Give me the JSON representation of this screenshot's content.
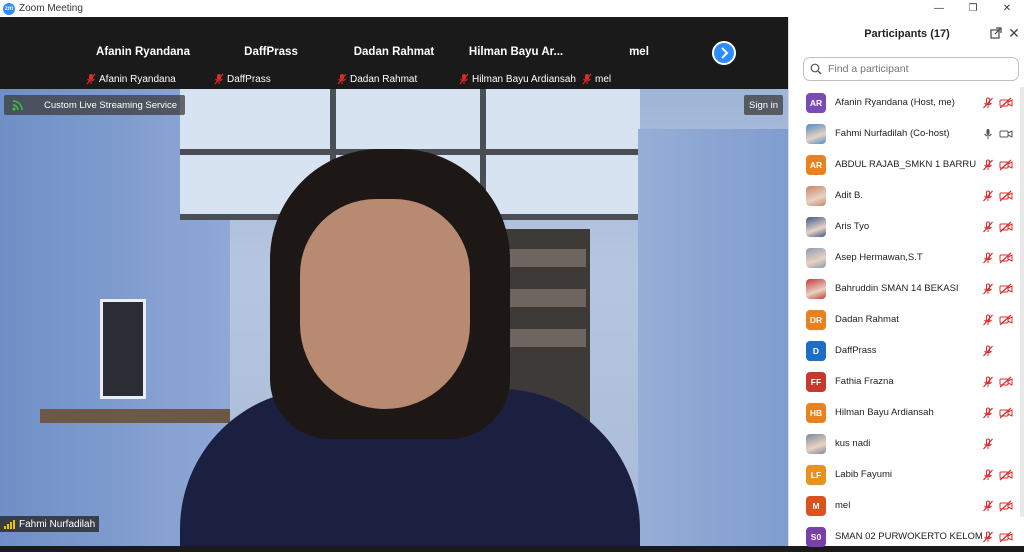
{
  "window": {
    "app_logo": "zm",
    "title": "Zoom Meeting",
    "controls": [
      "—",
      "❐",
      "✕"
    ]
  },
  "gallery_strip": {
    "tiles": [
      {
        "name": "Afanin Ryandana",
        "label": "Afanin Ryandana"
      },
      {
        "name": "DaffPrass",
        "label": "DaffPrass"
      },
      {
        "name": "Dadan Rahmat",
        "label": "Dadan Rahmat"
      },
      {
        "name": "Hilman Bayu Ar...",
        "label": "Hilman Bayu Ardiansah"
      },
      {
        "name": "mel",
        "label": "mel"
      }
    ],
    "next_icon": "chevron-right-icon"
  },
  "main_video": {
    "streaming_label": "Custom Live Streaming Service",
    "sign_in_label": "Sign in",
    "speaker_name": "Fahmi Nurfadilah"
  },
  "participants_panel": {
    "title": "Participants (17)",
    "search_placeholder": "Find a participant",
    "participants": [
      {
        "initials": "AR",
        "name": "Afanin Ryandana (Host, me)",
        "avatar_color": "#7b4bb5",
        "photo": false,
        "mic_muted": true,
        "video_off": true
      },
      {
        "initials": "",
        "name": "Fahmi Nurfadilah (Co-host)",
        "avatar_color": "#4a8bc4",
        "photo": true,
        "mic_muted": false,
        "video_off": false
      },
      {
        "initials": "AR",
        "name": "ABDUL RAJAB_SMKN 1 BARRU",
        "avatar_color": "#e8811e",
        "photo": false,
        "mic_muted": true,
        "video_off": true
      },
      {
        "initials": "",
        "name": "Adit B.",
        "avatar_color": "#c9846a",
        "photo": true,
        "mic_muted": true,
        "video_off": true
      },
      {
        "initials": "",
        "name": "Aris Tyo",
        "avatar_color": "#3b5a8a",
        "photo": true,
        "mic_muted": true,
        "video_off": true
      },
      {
        "initials": "",
        "name": "Asep Hermawan,S.T",
        "avatar_color": "#8a9bb0",
        "photo": true,
        "mic_muted": true,
        "video_off": true
      },
      {
        "initials": "",
        "name": "Bahruddin SMAN 14 BEKASI",
        "avatar_color": "#c43b3b",
        "photo": true,
        "mic_muted": true,
        "video_off": true
      },
      {
        "initials": "DR",
        "name": "Dadan Rahmat",
        "avatar_color": "#e8811e",
        "photo": false,
        "mic_muted": true,
        "video_off": true
      },
      {
        "initials": "D",
        "name": "DaffPrass",
        "avatar_color": "#1e6fc4",
        "photo": false,
        "mic_muted": true,
        "video_off": false
      },
      {
        "initials": "FF",
        "name": "Fathia Frazna",
        "avatar_color": "#c7382e",
        "photo": false,
        "mic_muted": true,
        "video_off": true
      },
      {
        "initials": "HB",
        "name": "Hilman Bayu Ardiansah",
        "avatar_color": "#e8811e",
        "photo": false,
        "mic_muted": true,
        "video_off": true
      },
      {
        "initials": "",
        "name": "kus nadi",
        "avatar_color": "#7d8a99",
        "photo": true,
        "mic_muted": true,
        "video_off": false
      },
      {
        "initials": "LF",
        "name": "Labib Fayumi",
        "avatar_color": "#e8911e",
        "photo": false,
        "mic_muted": true,
        "video_off": true
      },
      {
        "initials": "M",
        "name": "mel",
        "avatar_color": "#d9531e",
        "photo": false,
        "mic_muted": true,
        "video_off": true
      },
      {
        "initials": "S0",
        "name": "SMAN 02 PURWOKERTO KELOMP...",
        "avatar_color": "#7b3fa8",
        "photo": false,
        "mic_muted": true,
        "video_off": true
      }
    ]
  },
  "colors": {
    "accent": "#2d8cff",
    "muted_red": "#e02828"
  }
}
